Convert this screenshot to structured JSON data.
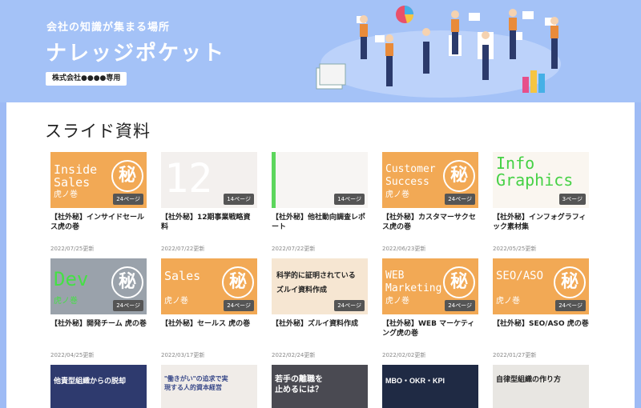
{
  "header": {
    "tagline": "会社の知識が集まる場所",
    "title": "ナレッジポケット",
    "company_badge": "株式会社●●●●専用"
  },
  "section": {
    "title": "スライド資料"
  },
  "cards": [
    {
      "thumb_title": "Inside\nSales",
      "thumb_sub": "虎ノ巻",
      "pages": "24ページ",
      "title": "【社外秘】インサイドセールス虎の巻",
      "date": "2022/07/25更新"
    },
    {
      "thumb_title": "12",
      "thumb_sub": "",
      "pages": "14ページ",
      "title": "【社外秘】12期事業戦略資料",
      "date": "2022/07/22更新"
    },
    {
      "thumb_title": "",
      "thumb_sub": "",
      "pages": "14ページ",
      "title": "【社外秘】他社動向調査レポート",
      "date": "2022/07/22更新"
    },
    {
      "thumb_title": "Customer\nSuccess",
      "thumb_sub": "虎ノ巻",
      "pages": "24ページ",
      "title": "【社外秘】カスタマーサクセス虎の巻",
      "date": "2022/06/23更新"
    },
    {
      "thumb_title": "Info\nGraphics",
      "thumb_sub": "",
      "pages": "3ページ",
      "title": "【社外秘】インフォグラフィック素材集",
      "date": "2022/05/25更新"
    },
    {
      "thumb_title": "Dev",
      "thumb_sub": "虎ノ巻",
      "pages": "24ページ",
      "title": "【社外秘】開発チーム 虎の巻",
      "date": "2022/04/25更新"
    },
    {
      "thumb_title": "Sales",
      "thumb_sub": "虎ノ巻",
      "pages": "24ページ",
      "title": "【社外秘】セールス 虎の巻",
      "date": "2022/03/17更新"
    },
    {
      "thumb_title": "科学的に証明されている\nズルイ資料作成",
      "thumb_sub": "",
      "pages": "24ページ",
      "title": "【社外秘】ズルイ資料作成",
      "date": "2022/02/24更新"
    },
    {
      "thumb_title": "WEB\nMarketing",
      "thumb_sub": "虎ノ巻",
      "pages": "24ページ",
      "title": "【社外秘】WEB マーケティング虎の巻",
      "date": "2022/02/02更新"
    },
    {
      "thumb_title": "SEO/ASO",
      "thumb_sub": "虎ノ巻",
      "pages": "24ページ",
      "title": "【社外秘】SEO/ASO 虎の巻",
      "date": "2022/01/27更新"
    }
  ],
  "bottom_thumbs": [
    {
      "text": "他責型組織からの脱却"
    },
    {
      "text": "\"働きがい\"の追求で実現する人的資本経営"
    },
    {
      "text": "若手の離職を止めるには？"
    },
    {
      "text": "MBO・OKR・KPI"
    },
    {
      "text": "自律型組織の作り方"
    }
  ],
  "seal_char": "秘"
}
